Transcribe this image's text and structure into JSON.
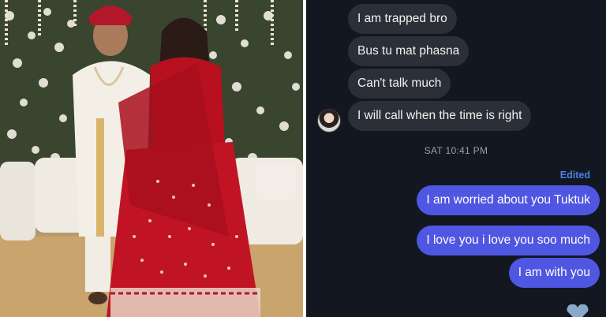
{
  "chat": {
    "received": [
      "I am trapped bro",
      "Bus tu mat phasna",
      "Can't talk much",
      "I will call when the time is right"
    ],
    "timestamp": "SAT 10:41 PM",
    "edited_label": "Edited",
    "sent": [
      "I am worried about you Tuktuk",
      "I love you i love you soo much",
      "I am with you"
    ],
    "reaction_icon": "heart-icon"
  },
  "colors": {
    "chat_background": "#121720",
    "incoming_bubble": "#2b2f37",
    "outgoing_bubble": "#4f56e2",
    "edited_label": "#4f7fe8"
  }
}
